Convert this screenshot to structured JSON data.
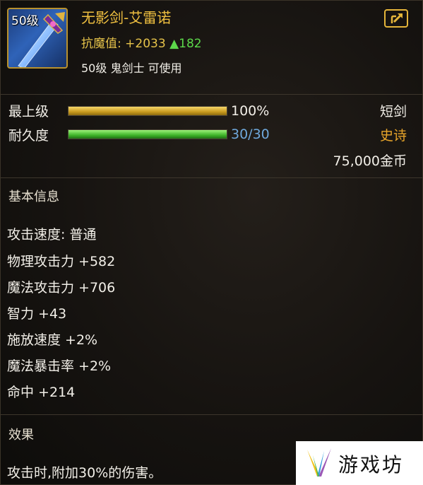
{
  "item": {
    "level_badge": "50级",
    "name": "无影剑-艾雷诺",
    "resist_label": "抗魔值:",
    "resist_value": "+2033",
    "resist_up": "▲182",
    "requirement": "50级 鬼剑士 可使用",
    "type": "短剑",
    "rarity": "史诗",
    "price": "75,000金币"
  },
  "stats": {
    "upgrade_label": "最上级",
    "upgrade_value": "100%",
    "upgrade_fraction": 1.0,
    "durability_label": "耐久度",
    "durability_value": "30/30",
    "durability_fraction": 1.0
  },
  "basic_info": {
    "title": "基本信息",
    "attributes": [
      "攻击速度: 普通",
      "物理攻击力 +582",
      "魔法攻击力 +706",
      "智力 +43",
      "施放速度 +2%",
      "魔法暴击率 +2%",
      "命中 +214"
    ]
  },
  "effect": {
    "title": "效果",
    "text": "攻击时,附加30%的伤害。"
  },
  "watermark": {
    "text": "游戏坊"
  },
  "colors": {
    "name": "#f0c040",
    "rarity": "#e8a52a",
    "durability_text": "#6fa8dc",
    "up_arrow": "#5cd84a",
    "frame": "#b8912e"
  },
  "icons": {
    "item": "sword-icon",
    "share": "share-icon",
    "watermark": "watermark-logo-icon"
  }
}
